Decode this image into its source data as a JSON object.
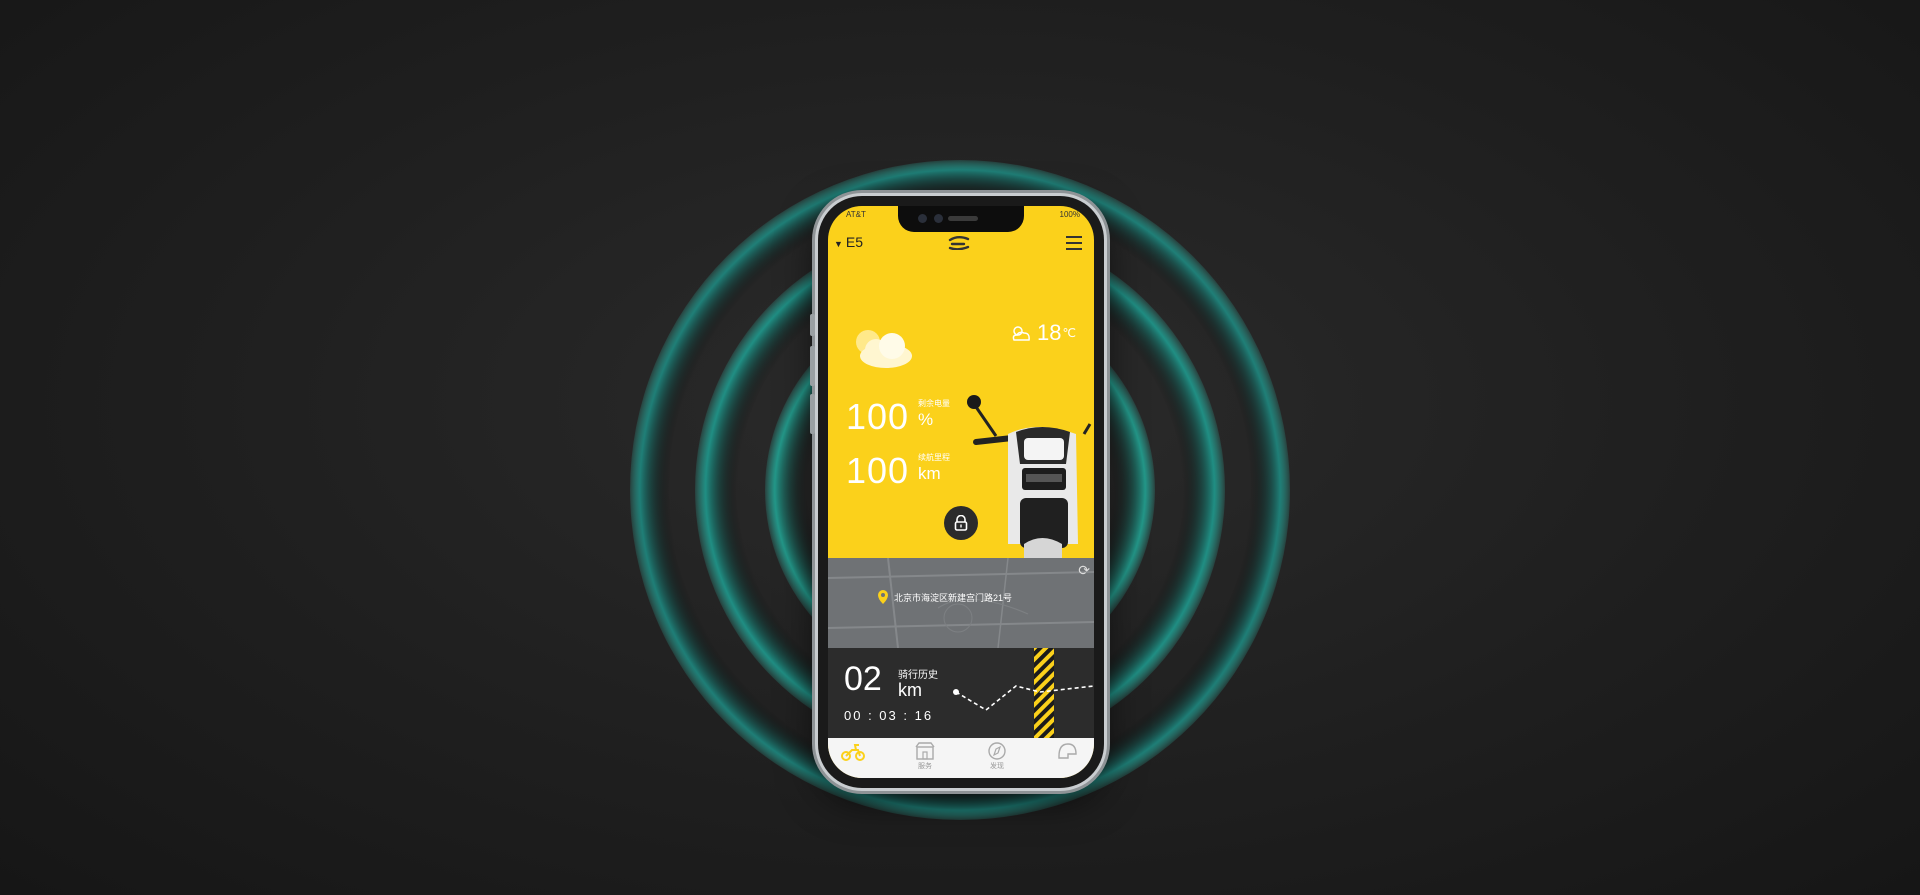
{
  "status_bar": {
    "carrier": "AT&T",
    "battery": "100%"
  },
  "header": {
    "model": "E5",
    "caret": "▼"
  },
  "weather": {
    "temperature": "18",
    "unit": "℃"
  },
  "battery_stat": {
    "value": "100",
    "unit": "%",
    "label": "剩余电量"
  },
  "range_stat": {
    "value": "100",
    "unit": "km",
    "label": "续航里程"
  },
  "map": {
    "address": "北京市海淀区新建宫门路21号"
  },
  "ride": {
    "distance": "02",
    "unit": "km",
    "label": "骑行历史",
    "duration": "00 : 03 : 16"
  },
  "tabs": [
    {
      "label": ""
    },
    {
      "label": "服务"
    },
    {
      "label": "发现"
    },
    {
      "label": ""
    }
  ],
  "colors": {
    "accent": "#fbd11b",
    "ring": "#2fb3a3",
    "dark": "#2c2c2c"
  }
}
